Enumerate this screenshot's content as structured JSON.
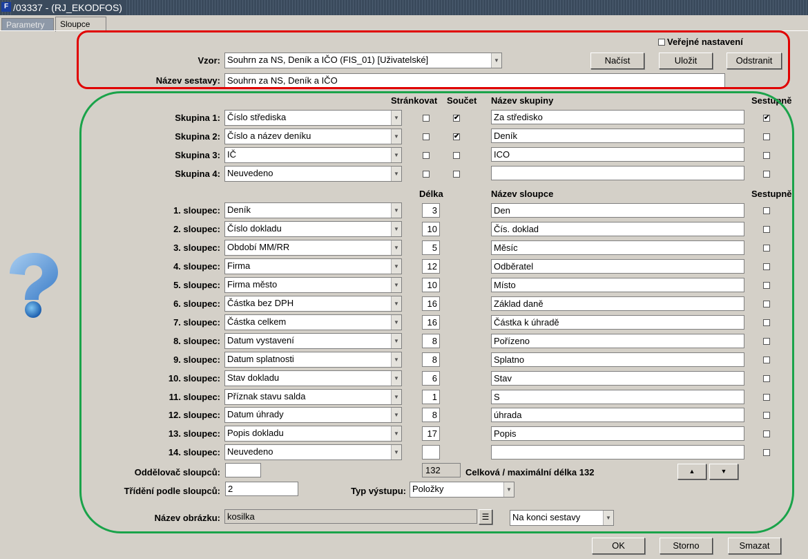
{
  "window": {
    "title": "/03337 - (RJ_EKODFOS)"
  },
  "tabs": [
    {
      "label": "Parametry"
    },
    {
      "label": "Sloupce"
    }
  ],
  "top": {
    "public_label": "Veřejné nastavení",
    "public_checked": false,
    "vzor_label": "Vzor:",
    "vzor_value": "Souhrn za NS, Deník a IČO   (FIS_01)  [Uživatelské]",
    "nazev_label": "Název sestavy:",
    "nazev_value": "Souhrn za NS, Deník a IČO",
    "load_btn": "Načíst",
    "save_btn": "Uložit",
    "remove_btn": "Odstranit"
  },
  "groups": {
    "header_page": "Stránkovat",
    "header_sum": "Součet",
    "header_name": "Název skupiny",
    "header_desc": "Sestupně",
    "rows": [
      {
        "label": "Skupina 1:",
        "value": "Číslo střediska",
        "page": false,
        "sum": true,
        "name": "Za středisko",
        "desc": true
      },
      {
        "label": "Skupina 2:",
        "value": "Číslo a název deníku",
        "page": false,
        "sum": true,
        "name": "Deník",
        "desc": false
      },
      {
        "label": "Skupina 3:",
        "value": "IČ",
        "page": false,
        "sum": false,
        "name": "ICO",
        "desc": false
      },
      {
        "label": "Skupina 4:",
        "value": "Neuvedeno",
        "page": false,
        "sum": false,
        "name": "",
        "desc": false
      }
    ]
  },
  "columns": {
    "header_len": "Délka",
    "header_name": "Název sloupce",
    "header_desc": "Sestupně",
    "rows": [
      {
        "label": "1. sloupec:",
        "value": "Deník",
        "len": "3",
        "name": "Den",
        "desc": false
      },
      {
        "label": "2. sloupec:",
        "value": "Číslo dokladu",
        "len": "10",
        "name": "Čís. doklad",
        "desc": false
      },
      {
        "label": "3. sloupec:",
        "value": "Období MM/RR",
        "len": "5",
        "name": "Měsíc",
        "desc": false
      },
      {
        "label": "4. sloupec:",
        "value": "Firma",
        "len": "12",
        "name": "Odběratel",
        "desc": false
      },
      {
        "label": "5. sloupec:",
        "value": "Firma město",
        "len": "10",
        "name": "Místo",
        "desc": false
      },
      {
        "label": "6. sloupec:",
        "value": "Částka bez DPH",
        "len": "16",
        "name": "Základ daně",
        "desc": false
      },
      {
        "label": "7. sloupec:",
        "value": "Částka celkem",
        "len": "16",
        "name": "Částka k úhradě",
        "desc": false
      },
      {
        "label": "8. sloupec:",
        "value": "Datum vystavení",
        "len": "8",
        "name": "Pořízeno",
        "desc": false
      },
      {
        "label": "9. sloupec:",
        "value": "Datum splatnosti",
        "len": "8",
        "name": "Splatno",
        "desc": false
      },
      {
        "label": "10. sloupec:",
        "value": "Stav dokladu",
        "len": "6",
        "name": "Stav",
        "desc": false
      },
      {
        "label": "11. sloupec:",
        "value": "Příznak stavu salda",
        "len": "1",
        "name": "S",
        "desc": false
      },
      {
        "label": "12. sloupec:",
        "value": "Datum úhrady",
        "len": "8",
        "name": "úhrada",
        "desc": false
      },
      {
        "label": "13. sloupec:",
        "value": "Popis dokladu",
        "len": "17",
        "name": "Popis",
        "desc": false
      },
      {
        "label": "14. sloupec:",
        "value": "Neuvedeno",
        "len": "",
        "name": "",
        "desc": false
      }
    ]
  },
  "bottom": {
    "separator_label": "Oddělovač sloupců:",
    "separator_value": "",
    "total_len": "132",
    "total_text": "Celková / maximální délka 132",
    "sort_label": "Třídění podle sloupců:",
    "sort_value": "2",
    "output_label": "Typ výstupu:",
    "output_value": "Položky",
    "image_label": "Název obrázku:",
    "image_value": "kosilka",
    "image_pos_value": "Na konci sestavy"
  },
  "footer": {
    "ok": "OK",
    "cancel": "Storno",
    "delete": "Smazat"
  },
  "icons": {
    "up": "▲",
    "down": "▼",
    "list": "☰",
    "check": "✔"
  },
  "colors": {
    "background": "#d4d0c8",
    "red_frame": "#e00000",
    "green_frame": "#1aa34a"
  }
}
